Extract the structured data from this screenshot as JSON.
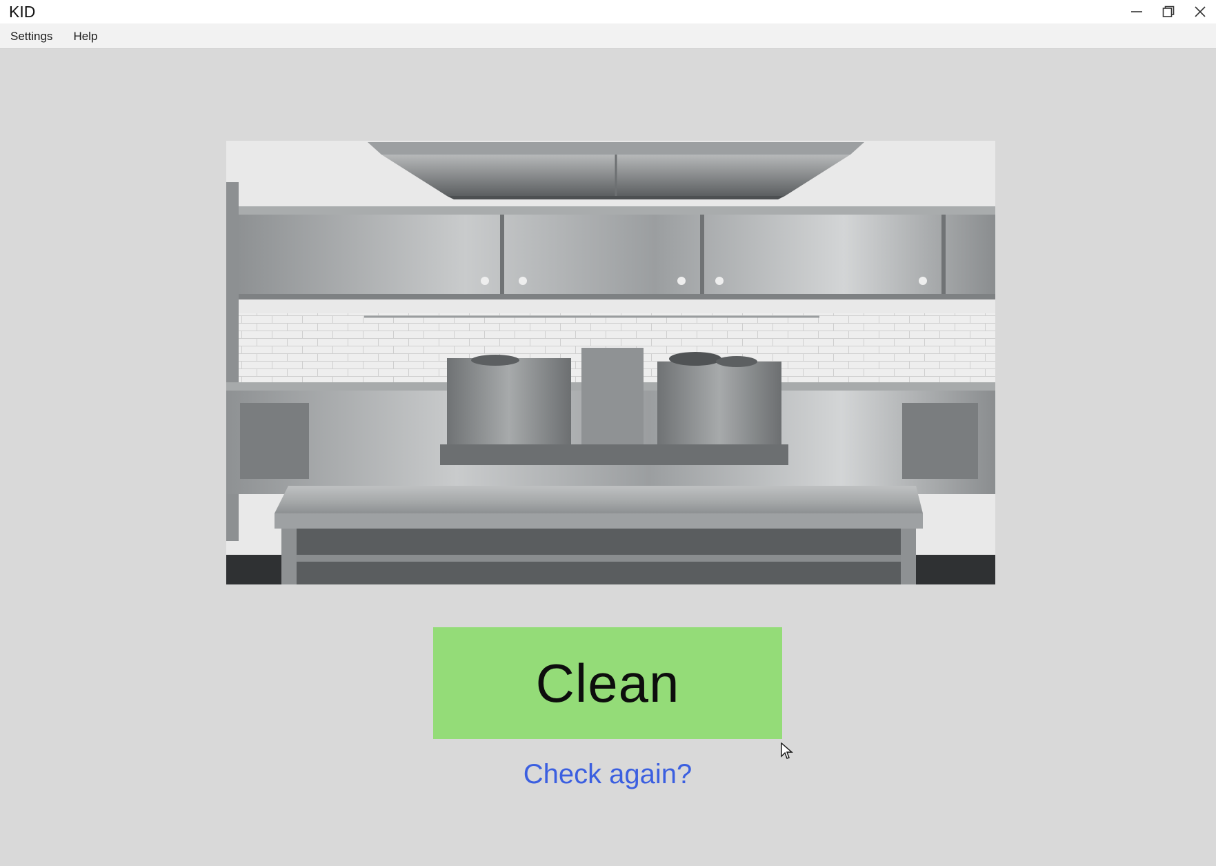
{
  "window": {
    "title": "KID"
  },
  "menu": {
    "items": [
      {
        "label": "Settings"
      },
      {
        "label": "Help"
      }
    ]
  },
  "window_controls": {
    "minimize_icon": "minimize-icon",
    "maximize_icon": "maximize-icon",
    "close_icon": "close-icon"
  },
  "main": {
    "image_subject": "stainless steel commercial kitchen",
    "result_label": "Clean",
    "result_color": "#94dc78",
    "check_again_label": "Check again?",
    "link_color": "#3b5fe0"
  }
}
